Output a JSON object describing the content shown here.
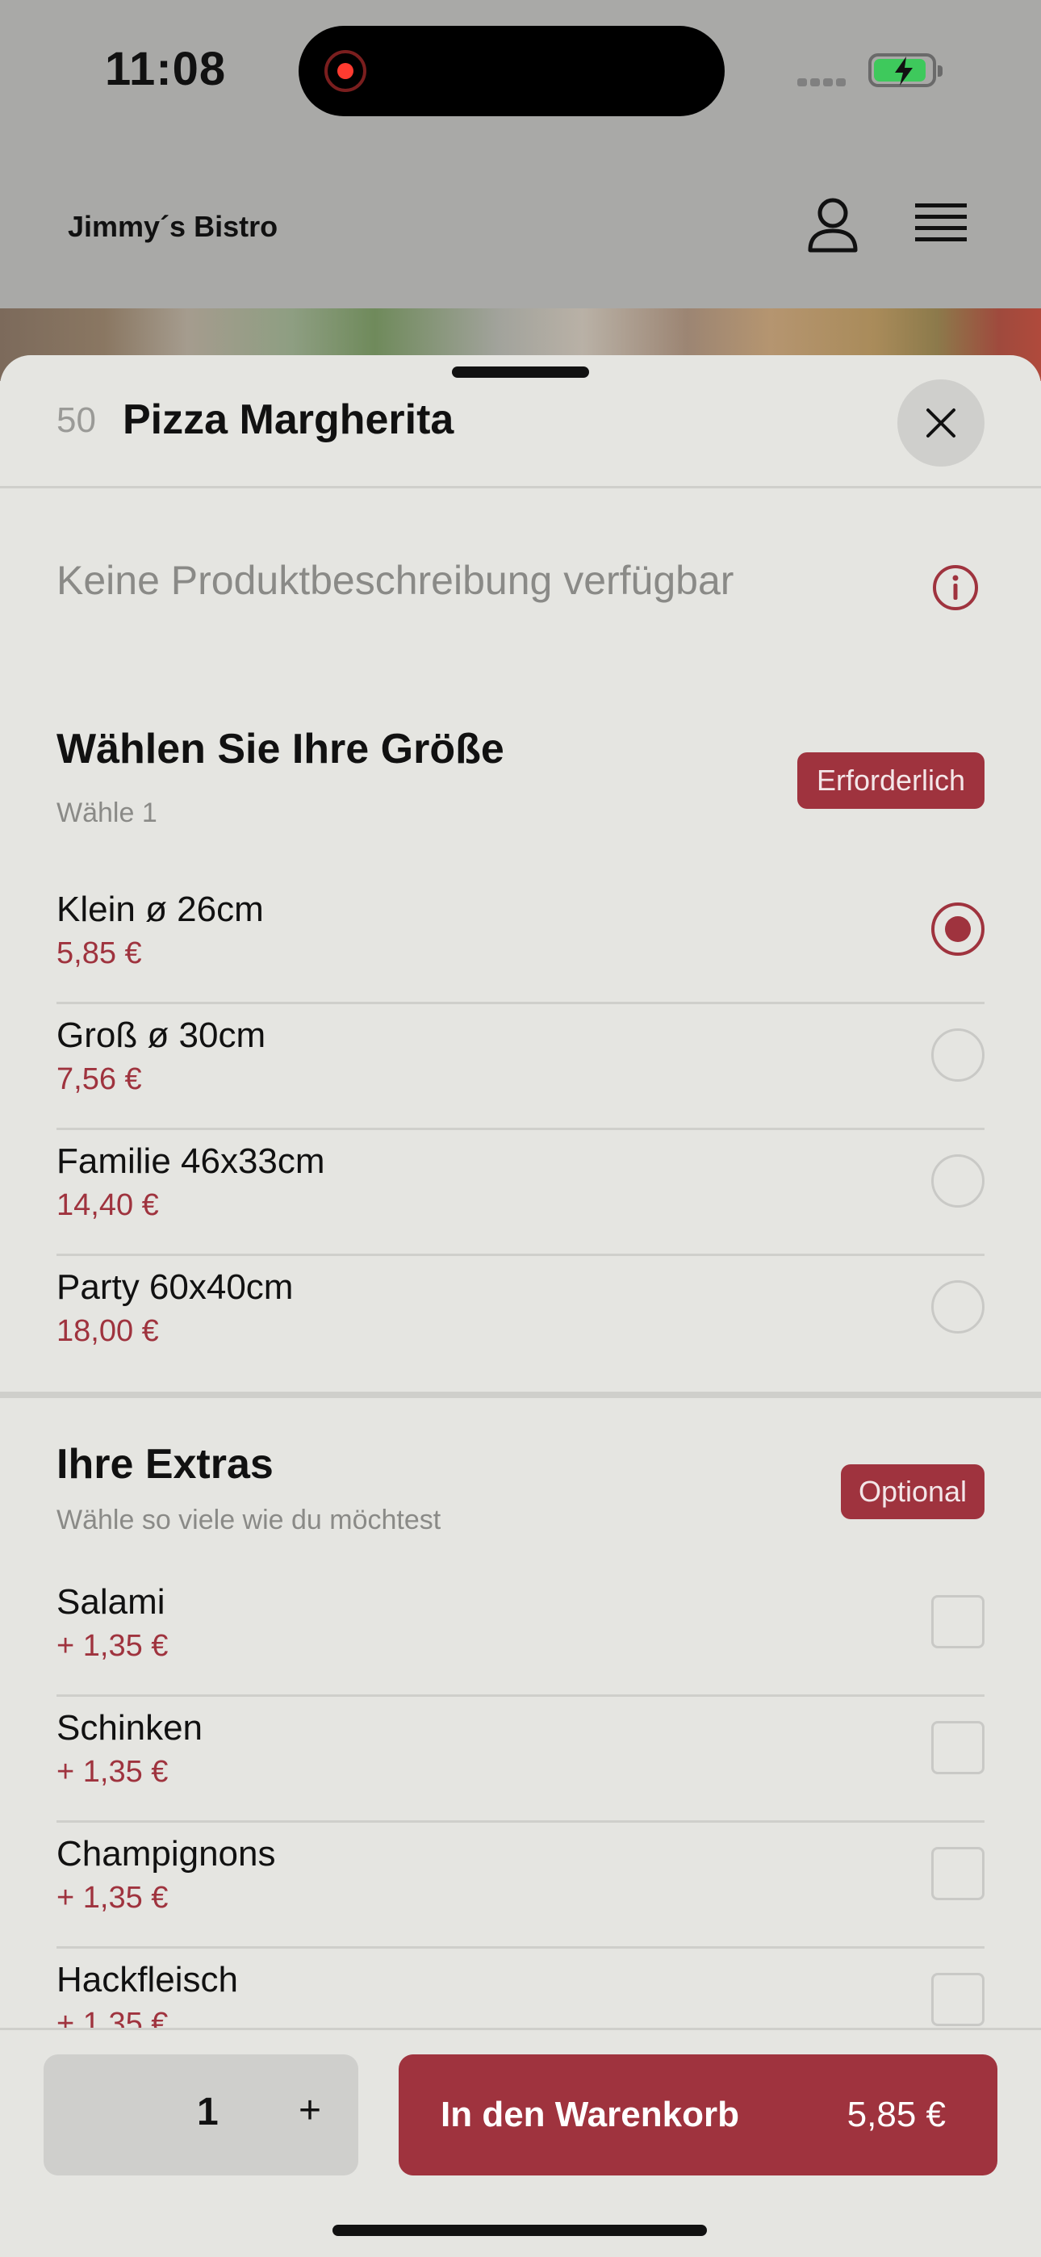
{
  "status_bar": {
    "time": "11:08"
  },
  "header": {
    "brand": "Jimmy´s Bistro",
    "profile_icon": "person-icon",
    "menu_icon": "hamburger-icon"
  },
  "product": {
    "number": "50",
    "name": "Pizza Margherita",
    "description": "Keine Produktbeschreibung verfügbar"
  },
  "size_section": {
    "title": "Wählen Sie Ihre Größe",
    "subtitle": "Wähle 1",
    "badge": "Erforderlich",
    "options": [
      {
        "name": "Klein ø 26cm",
        "price": "5,85 €",
        "selected": true
      },
      {
        "name": "Groß ø 30cm",
        "price": "7,56 €",
        "selected": false
      },
      {
        "name": "Familie 46x33cm",
        "price": "14,40 €",
        "selected": false
      },
      {
        "name": "Party 60x40cm",
        "price": "18,00 €",
        "selected": false
      }
    ]
  },
  "extras_section": {
    "title": "Ihre Extras",
    "subtitle": "Wähle so viele wie du möchtest",
    "badge": "Optional",
    "options": [
      {
        "name": "Salami",
        "price": "+ 1,35 €"
      },
      {
        "name": "Schinken",
        "price": "+ 1,35 €"
      },
      {
        "name": "Champignons",
        "price": "+ 1,35 €"
      },
      {
        "name": "Hackfleisch",
        "price": "+ 1,35 €"
      }
    ]
  },
  "bottom_bar": {
    "quantity": "1",
    "plus_label": "+",
    "cart_label": "In den Warenkorb",
    "cart_amount": "5,85 €"
  },
  "colors": {
    "accent": "#9f333e",
    "background": "#e5e5e1",
    "backdrop": "#a9a9a7"
  }
}
